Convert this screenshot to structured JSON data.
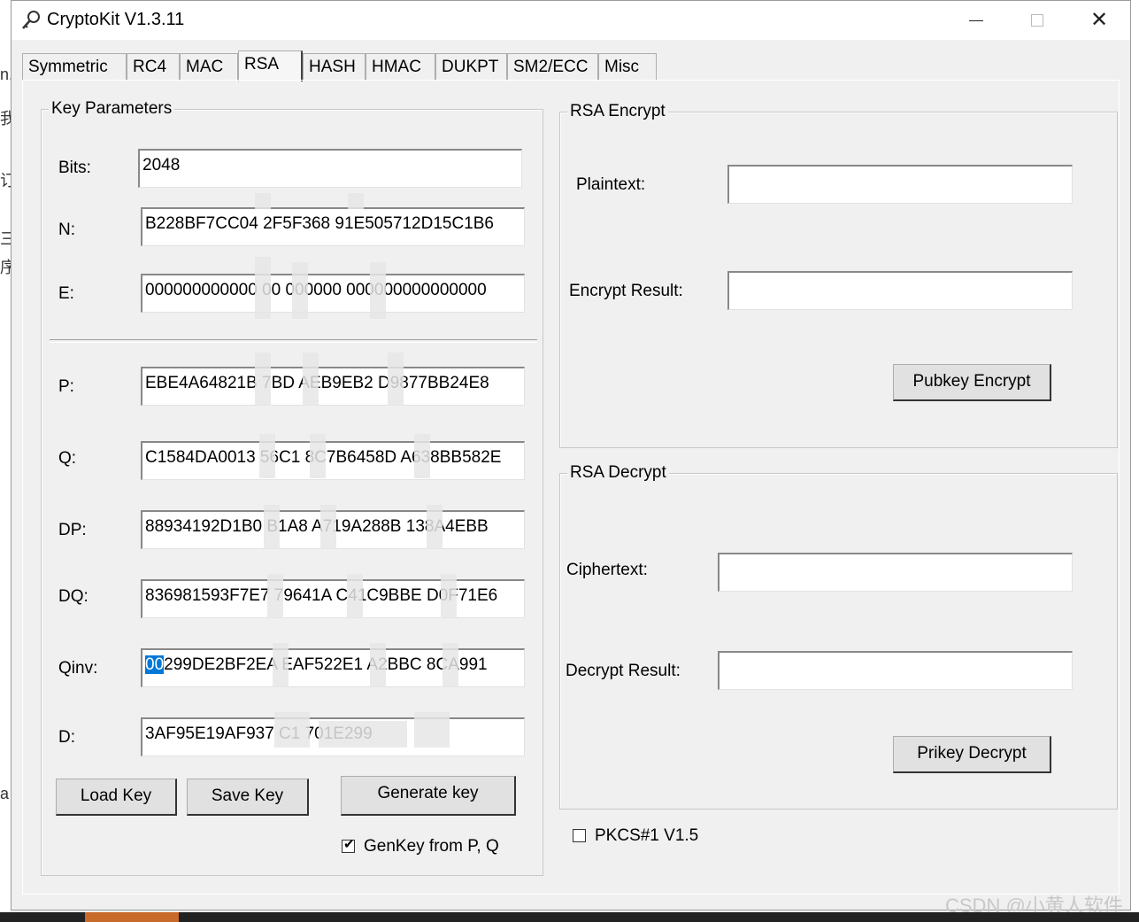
{
  "window": {
    "title": "CryptoKit V1.3.11"
  },
  "tabs": [
    {
      "label": "Symmetric"
    },
    {
      "label": "RC4"
    },
    {
      "label": "MAC"
    },
    {
      "label": "RSA"
    },
    {
      "label": "HASH"
    },
    {
      "label": "HMAC"
    },
    {
      "label": "DUKPT"
    },
    {
      "label": "SM2/ECC"
    },
    {
      "label": "Misc"
    }
  ],
  "active_tab": "RSA",
  "key_params": {
    "title": "Key Parameters",
    "bits": {
      "label": "Bits:",
      "value": "2048"
    },
    "n": {
      "label": "N:",
      "value": "B228BF7CC04 2F5F368 91E505712D15C1B6"
    },
    "e": {
      "label": "E:",
      "value": "000000000000 00 000000 000000000000000"
    },
    "p": {
      "label": "P:",
      "value": "EBE4A64821B 7BD AEB9EB2 D9877BB24E8"
    },
    "q": {
      "label": "Q:",
      "value": "C1584DA0013 56C1 8C7B6458D A638BB582E"
    },
    "dp": {
      "label": "DP:",
      "value": "88934192D1B0 B1A8 A719A288B 138A4EBB"
    },
    "dq": {
      "label": "DQ:",
      "value": "836981593F7E7 79641A C41C9BBE D0F71E6"
    },
    "qinv": {
      "label": "Qinv:",
      "value_selected": "00",
      "value_rest": "299DE2BF2EA EAF522E1 A2BBC 8CA991"
    },
    "d": {
      "label": "D:",
      "value": "3AF95E19AF937 C1 701E299"
    },
    "load_key": "Load Key",
    "save_key": "Save Key",
    "generate_key": "Generate key",
    "genkey_from_pq": {
      "label": "GenKey from P, Q",
      "checked": true
    }
  },
  "encrypt": {
    "title": "RSA Encrypt",
    "plaintext_label": "Plaintext:",
    "plaintext_value": "",
    "result_label": "Encrypt Result:",
    "result_value": "",
    "button": "Pubkey Encrypt"
  },
  "decrypt": {
    "title": "RSA Decrypt",
    "ciphertext_label": "Ciphertext:",
    "ciphertext_value": "",
    "result_label": "Decrypt Result:",
    "result_value": "",
    "button": "Prikey Decrypt"
  },
  "pkcs": {
    "label": "PKCS#1 V1.5",
    "checked": false
  },
  "watermark": "CSDN @小黄人软件",
  "colors": {
    "selection": "#0078d7",
    "window_bg": "#f0f0f0",
    "titlebar_bg": "#ffffff"
  }
}
